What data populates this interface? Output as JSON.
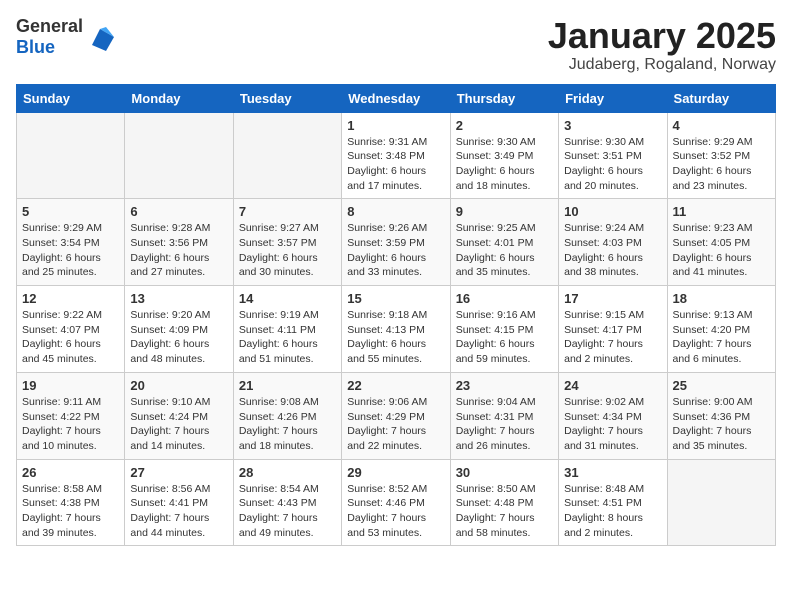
{
  "header": {
    "logo_general": "General",
    "logo_blue": "Blue",
    "month": "January 2025",
    "location": "Judaberg, Rogaland, Norway"
  },
  "days_of_week": [
    "Sunday",
    "Monday",
    "Tuesday",
    "Wednesday",
    "Thursday",
    "Friday",
    "Saturday"
  ],
  "weeks": [
    [
      {
        "day": "",
        "info": ""
      },
      {
        "day": "",
        "info": ""
      },
      {
        "day": "",
        "info": ""
      },
      {
        "day": "1",
        "info": "Sunrise: 9:31 AM\nSunset: 3:48 PM\nDaylight: 6 hours\nand 17 minutes."
      },
      {
        "day": "2",
        "info": "Sunrise: 9:30 AM\nSunset: 3:49 PM\nDaylight: 6 hours\nand 18 minutes."
      },
      {
        "day": "3",
        "info": "Sunrise: 9:30 AM\nSunset: 3:51 PM\nDaylight: 6 hours\nand 20 minutes."
      },
      {
        "day": "4",
        "info": "Sunrise: 9:29 AM\nSunset: 3:52 PM\nDaylight: 6 hours\nand 23 minutes."
      }
    ],
    [
      {
        "day": "5",
        "info": "Sunrise: 9:29 AM\nSunset: 3:54 PM\nDaylight: 6 hours\nand 25 minutes."
      },
      {
        "day": "6",
        "info": "Sunrise: 9:28 AM\nSunset: 3:56 PM\nDaylight: 6 hours\nand 27 minutes."
      },
      {
        "day": "7",
        "info": "Sunrise: 9:27 AM\nSunset: 3:57 PM\nDaylight: 6 hours\nand 30 minutes."
      },
      {
        "day": "8",
        "info": "Sunrise: 9:26 AM\nSunset: 3:59 PM\nDaylight: 6 hours\nand 33 minutes."
      },
      {
        "day": "9",
        "info": "Sunrise: 9:25 AM\nSunset: 4:01 PM\nDaylight: 6 hours\nand 35 minutes."
      },
      {
        "day": "10",
        "info": "Sunrise: 9:24 AM\nSunset: 4:03 PM\nDaylight: 6 hours\nand 38 minutes."
      },
      {
        "day": "11",
        "info": "Sunrise: 9:23 AM\nSunset: 4:05 PM\nDaylight: 6 hours\nand 41 minutes."
      }
    ],
    [
      {
        "day": "12",
        "info": "Sunrise: 9:22 AM\nSunset: 4:07 PM\nDaylight: 6 hours\nand 45 minutes."
      },
      {
        "day": "13",
        "info": "Sunrise: 9:20 AM\nSunset: 4:09 PM\nDaylight: 6 hours\nand 48 minutes."
      },
      {
        "day": "14",
        "info": "Sunrise: 9:19 AM\nSunset: 4:11 PM\nDaylight: 6 hours\nand 51 minutes."
      },
      {
        "day": "15",
        "info": "Sunrise: 9:18 AM\nSunset: 4:13 PM\nDaylight: 6 hours\nand 55 minutes."
      },
      {
        "day": "16",
        "info": "Sunrise: 9:16 AM\nSunset: 4:15 PM\nDaylight: 6 hours\nand 59 minutes."
      },
      {
        "day": "17",
        "info": "Sunrise: 9:15 AM\nSunset: 4:17 PM\nDaylight: 7 hours\nand 2 minutes."
      },
      {
        "day": "18",
        "info": "Sunrise: 9:13 AM\nSunset: 4:20 PM\nDaylight: 7 hours\nand 6 minutes."
      }
    ],
    [
      {
        "day": "19",
        "info": "Sunrise: 9:11 AM\nSunset: 4:22 PM\nDaylight: 7 hours\nand 10 minutes."
      },
      {
        "day": "20",
        "info": "Sunrise: 9:10 AM\nSunset: 4:24 PM\nDaylight: 7 hours\nand 14 minutes."
      },
      {
        "day": "21",
        "info": "Sunrise: 9:08 AM\nSunset: 4:26 PM\nDaylight: 7 hours\nand 18 minutes."
      },
      {
        "day": "22",
        "info": "Sunrise: 9:06 AM\nSunset: 4:29 PM\nDaylight: 7 hours\nand 22 minutes."
      },
      {
        "day": "23",
        "info": "Sunrise: 9:04 AM\nSunset: 4:31 PM\nDaylight: 7 hours\nand 26 minutes."
      },
      {
        "day": "24",
        "info": "Sunrise: 9:02 AM\nSunset: 4:34 PM\nDaylight: 7 hours\nand 31 minutes."
      },
      {
        "day": "25",
        "info": "Sunrise: 9:00 AM\nSunset: 4:36 PM\nDaylight: 7 hours\nand 35 minutes."
      }
    ],
    [
      {
        "day": "26",
        "info": "Sunrise: 8:58 AM\nSunset: 4:38 PM\nDaylight: 7 hours\nand 39 minutes."
      },
      {
        "day": "27",
        "info": "Sunrise: 8:56 AM\nSunset: 4:41 PM\nDaylight: 7 hours\nand 44 minutes."
      },
      {
        "day": "28",
        "info": "Sunrise: 8:54 AM\nSunset: 4:43 PM\nDaylight: 7 hours\nand 49 minutes."
      },
      {
        "day": "29",
        "info": "Sunrise: 8:52 AM\nSunset: 4:46 PM\nDaylight: 7 hours\nand 53 minutes."
      },
      {
        "day": "30",
        "info": "Sunrise: 8:50 AM\nSunset: 4:48 PM\nDaylight: 7 hours\nand 58 minutes."
      },
      {
        "day": "31",
        "info": "Sunrise: 8:48 AM\nSunset: 4:51 PM\nDaylight: 8 hours\nand 2 minutes."
      },
      {
        "day": "",
        "info": ""
      }
    ]
  ]
}
